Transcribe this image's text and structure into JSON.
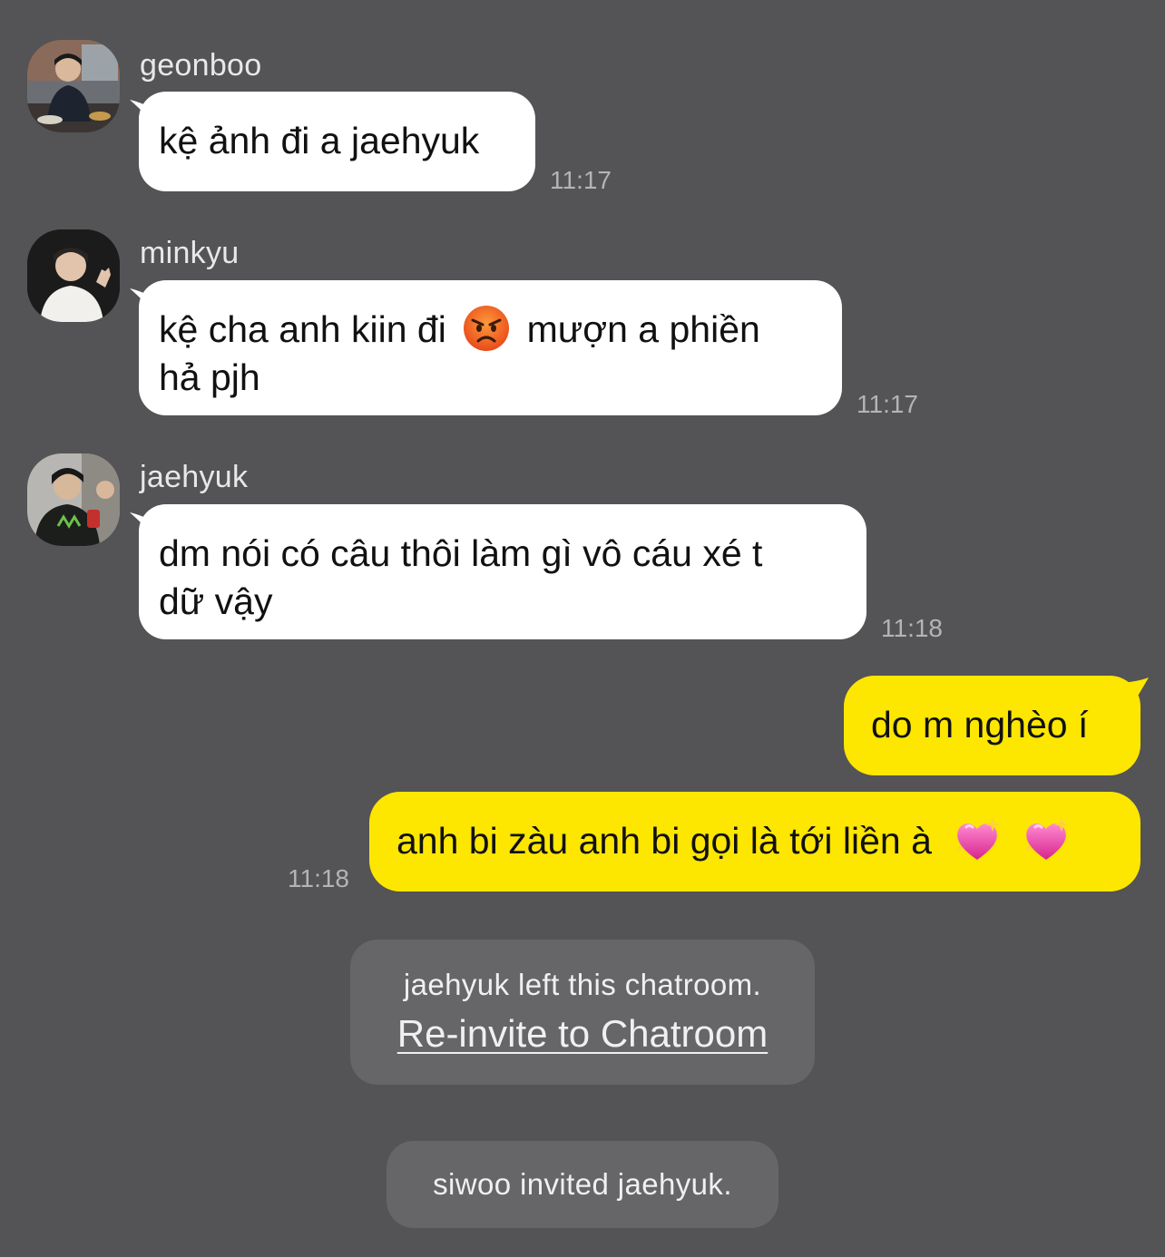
{
  "messages": [
    {
      "sender": "geonboo",
      "text": "kệ ảnh đi a jaehyuk",
      "time": "11:17"
    },
    {
      "sender": "minkyu",
      "text_before_emoji": "kệ cha anh kiin đi",
      "emoji": "angry-face",
      "text_after_emoji": "mượn a phiền",
      "text_line2": "hả pjh",
      "time": "11:17"
    },
    {
      "sender": "jaehyuk",
      "text_line1": "dm nói có câu thôi làm gì vô cáu xé t",
      "text_line2": "dữ vậy",
      "time": "11:18"
    },
    {
      "sender": "me",
      "text": "do m nghèo í"
    },
    {
      "sender": "me",
      "text": "anh bi zàu anh bi gọi là tới liền à",
      "emoji": "sparkling-heart",
      "time": "11:18"
    }
  ],
  "system_messages": [
    {
      "text": "jaehyuk left this chatroom.",
      "link": "Re-invite to Chatroom"
    },
    {
      "text": "siwoo invited jaehyuk."
    }
  ],
  "colors": {
    "background": "#545355",
    "incoming_bubble": "#ffffff",
    "outgoing_bubble": "#fde600",
    "system_bubble": "#666568",
    "timestamp": "#b4b4b4"
  }
}
